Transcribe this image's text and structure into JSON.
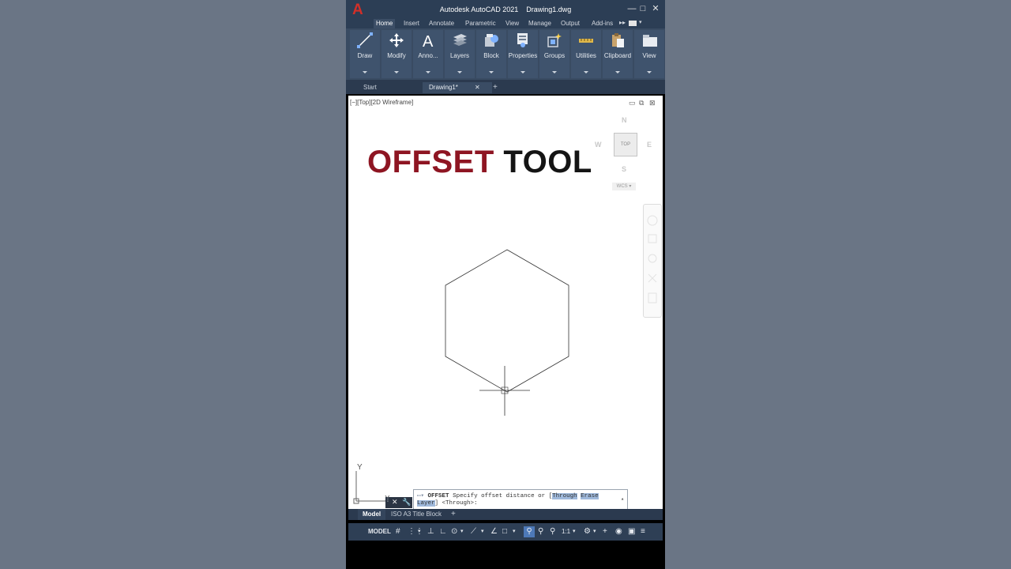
{
  "window": {
    "app_title": "Autodesk AutoCAD 2021",
    "doc_title": "Drawing1.dwg",
    "logo_letter": "A",
    "minimize_glyph": "—",
    "maximize_glyph": "□",
    "close_glyph": "✕"
  },
  "ribbon_tabs": [
    "Home",
    "Insert",
    "Annotate",
    "Parametric",
    "View",
    "Manage",
    "Output",
    "Add-ins"
  ],
  "ribbon_panels": [
    {
      "label": "Draw",
      "icon": "line-icon"
    },
    {
      "label": "Modify",
      "icon": "move-icon"
    },
    {
      "label": "Anno...",
      "icon": "text-icon"
    },
    {
      "label": "Layers",
      "icon": "layers-icon"
    },
    {
      "label": "Block",
      "icon": "block-icon"
    },
    {
      "label": "Properties",
      "icon": "properties-icon"
    },
    {
      "label": "Groups",
      "icon": "groups-icon"
    },
    {
      "label": "Utilities",
      "icon": "measure-icon"
    },
    {
      "label": "Clipboard",
      "icon": "clipboard-icon"
    },
    {
      "label": "View",
      "icon": "view-icon"
    }
  ],
  "file_tabs": {
    "start": "Start",
    "drawing": "Drawing1*",
    "close_glyph": "✕",
    "new_glyph": "+"
  },
  "viewport": {
    "label": "[−][Top][2D Wireframe]",
    "ctl_min": "▭",
    "ctl_restore": "⧉",
    "ctl_close": "⊠"
  },
  "headline": {
    "part1": "OFFSET",
    "part2": "TOOL"
  },
  "viewcube": {
    "n": "N",
    "s": "S",
    "e": "E",
    "w": "W",
    "top": "TOP",
    "wcs": "WCS ▾"
  },
  "ucs": {
    "y": "Y",
    "x": "X"
  },
  "command": {
    "name": "OFFSET",
    "prompt": "Specify offset distance or [",
    "opt_through": "Through",
    "opt_erase": "Erase",
    "opt_layer": "Layer",
    "tail": "] <Through>:"
  },
  "layout_tabs": {
    "model": "Model",
    "iso": "ISO A3 Title Block",
    "add": "+"
  },
  "status": {
    "model": "MODEL",
    "scale": "1:1"
  },
  "colors": {
    "title_bg": "#2c3e55",
    "ribbon_bg": "#394b62",
    "headline_red": "#8e1522",
    "highlight": "#9fb9dc"
  }
}
